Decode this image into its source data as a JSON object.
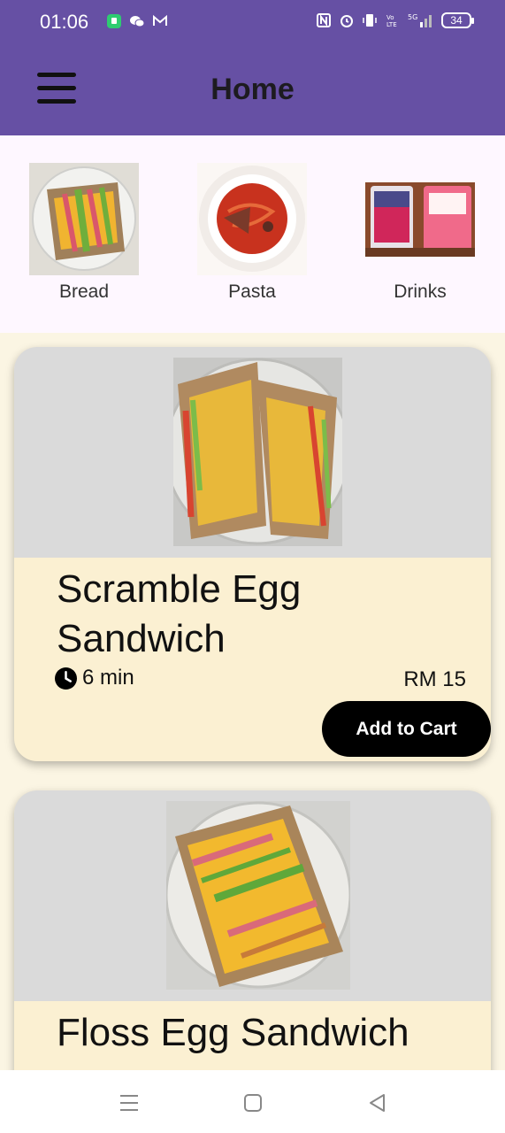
{
  "status_bar": {
    "time": "01:06",
    "battery": "34",
    "icons": [
      "app-icon",
      "wechat-icon",
      "mail-icon",
      "nfc-icon",
      "alarm-icon",
      "vibrate-icon",
      "volte-icon",
      "signal-5g-icon",
      "battery-icon"
    ]
  },
  "header": {
    "title": "Home",
    "menu_icon": "hamburger-menu-icon",
    "background": "#6650a4"
  },
  "categories": [
    {
      "label": "Bread"
    },
    {
      "label": "Pasta"
    },
    {
      "label": "Drinks"
    }
  ],
  "foods": [
    {
      "name": "Scramble Egg Sandwich",
      "time": "6 min",
      "price": "RM 15",
      "button_label": "Add to Cart"
    },
    {
      "name": "Floss Egg Sandwich"
    }
  ],
  "navbar": {
    "icons": [
      "recent-apps-icon",
      "home-icon",
      "back-icon"
    ]
  },
  "colors": {
    "accent": "#6650a4",
    "card_body": "#fbf0d2",
    "card_image_bg": "#dadada",
    "page_bg": "#fbf5e3",
    "button": "#000000"
  }
}
